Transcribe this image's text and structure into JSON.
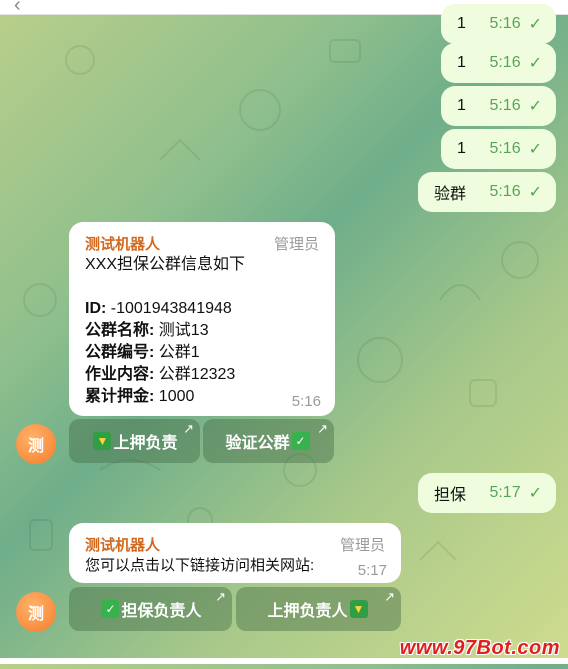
{
  "header": {
    "back_icon": "‹"
  },
  "outgoing": [
    {
      "text": "1",
      "time": "5:16"
    },
    {
      "text": "1",
      "time": "5:16"
    },
    {
      "text": "1",
      "time": "5:16"
    },
    {
      "text": "1",
      "time": "5:16"
    },
    {
      "text": "验群",
      "time": "5:16"
    },
    {
      "text": "担保",
      "time": "5:17"
    }
  ],
  "msg1": {
    "sender": "测试机器人",
    "role": "管理员",
    "title": "XXX担保公群信息如下",
    "fields": [
      {
        "label": "ID:",
        "value": " -1001943841948"
      },
      {
        "label": "公群名称:",
        "value": " 测试13"
      },
      {
        "label": "公群编号:",
        "value": " 公群1"
      },
      {
        "label": "作业内容:",
        "value": " 公群12323"
      },
      {
        "label": "累计押金:",
        "value": " 1000"
      }
    ],
    "time": "5:16",
    "avatar": "测",
    "buttons": [
      {
        "label": "上押负责",
        "icon": "beginner-icon"
      },
      {
        "label": "验证公群",
        "icon": "check-mark-icon"
      }
    ]
  },
  "msg2": {
    "sender": "测试机器人",
    "role": "管理员",
    "text": "您可以点击以下链接访问相关网站:",
    "time": "5:17",
    "avatar": "测",
    "buttons": [
      {
        "label": "担保负责人",
        "icon": "check-mark-icon"
      },
      {
        "label": "上押负责人",
        "icon": "beginner-icon"
      }
    ]
  },
  "watermark": "www.97Bot.com"
}
